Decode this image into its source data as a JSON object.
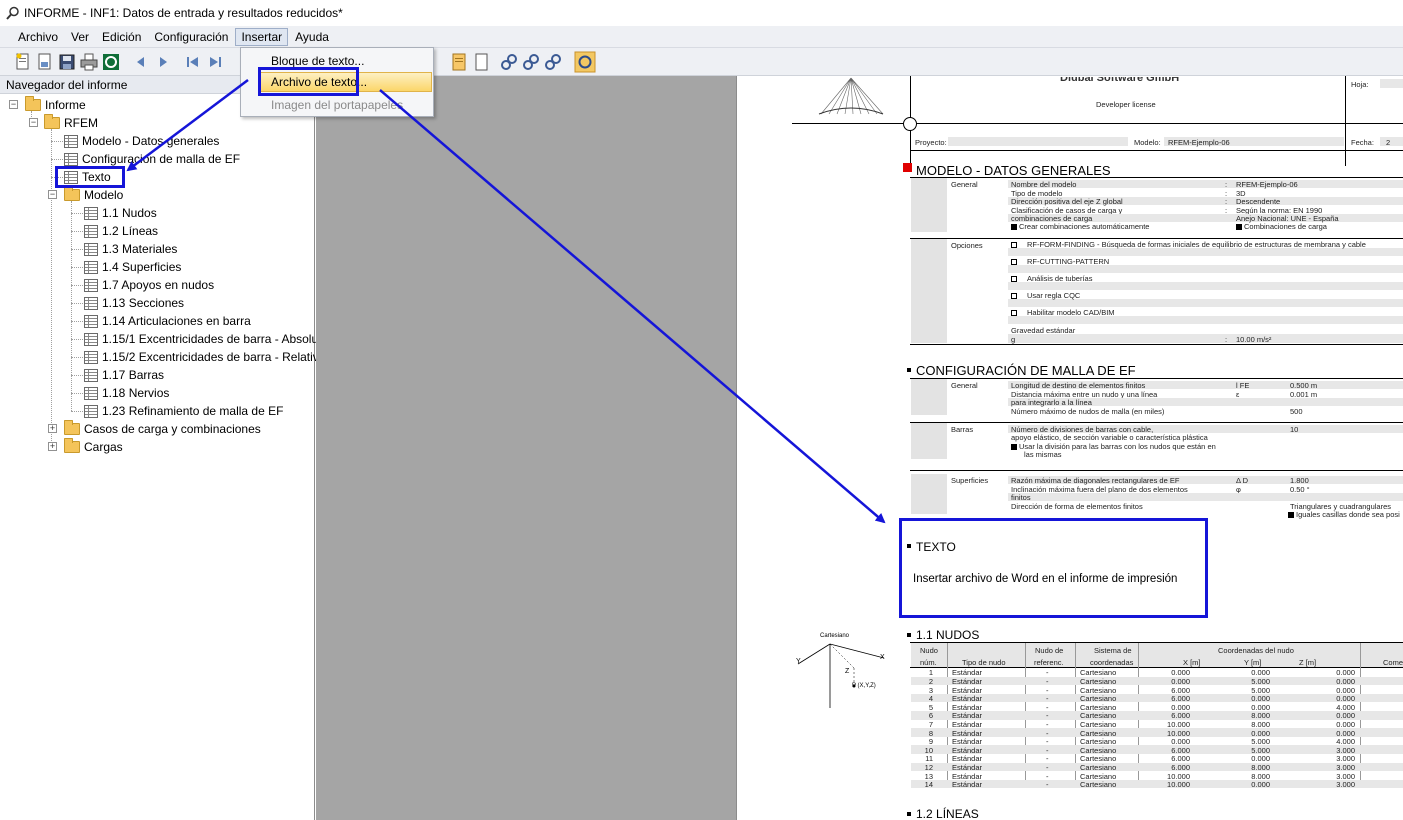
{
  "window": {
    "title": "INFORME - INF1: Datos de entrada y resultados reducidos*"
  },
  "menubar": {
    "items": [
      "Archivo",
      "Ver",
      "Edición",
      "Configuración",
      "Insertar",
      "Ayuda"
    ],
    "active": "Insertar"
  },
  "dropdown": {
    "items": [
      "Bloque de texto...",
      "Archivo de texto...",
      "Imagen del portapapeles"
    ],
    "highlighted": "Archivo de texto..."
  },
  "navigator": {
    "title": "Navegador del informe",
    "root": "Informe",
    "rfem": "RFEM",
    "items": [
      "Modelo - Datos generales",
      "Configuración de malla de EF",
      "Texto"
    ],
    "modelo": "Modelo",
    "modelo_items": [
      "1.1 Nudos",
      "1.2 Líneas",
      "1.3 Materiales",
      "1.4 Superficies",
      "1.7 Apoyos en nudos",
      "1.13 Secciones",
      "1.14 Articulaciones en barra",
      "1.15/1 Excentricidades de barra - Absolu",
      "1.15/2 Excentricidades de barra - Relativ",
      "1.17 Barras",
      "1.18 Nervios",
      "1.23 Refinamiento de malla de EF"
    ],
    "bottom": [
      "Casos de carga y combinaciones",
      "Cargas"
    ]
  },
  "doc": {
    "company": "Dlubal Software GmbH",
    "license": "Developer license",
    "sheet_label": "Hoja:",
    "proyecto_label": "Proyecto:",
    "modelo_label": "Modelo:",
    "modelo_value": "RFEM-Ejemplo-06",
    "fecha_label": "Fecha:",
    "fecha_value": "2",
    "sec1": {
      "title": "MODELO - DATOS GENERALES",
      "general_label": "General",
      "rows": [
        {
          "k": "Nombre del modelo",
          "v": "RFEM-Ejemplo-06"
        },
        {
          "k": "Tipo de modelo",
          "v": "3D"
        },
        {
          "k": "Dirección positiva del eje Z global",
          "v": "Descendente"
        },
        {
          "k": "Clasificación de casos de carga y",
          "v": "Según la norma: EN 1990"
        },
        {
          "k": "combinaciones de carga",
          "v": "Anejo Nacional: UNE - España"
        }
      ],
      "chk1": "Crear combinaciones automáticamente",
      "chk2": "Combinaciones de carga",
      "opciones_label": "Opciones",
      "opts": [
        "RF-FORM-FINDING - Búsqueda de formas iniciales de equilibrio de estructuras de membrana y cable",
        "RF-CUTTING-PATTERN",
        "Análisis de tuberías",
        "Usar regla CQC",
        "Habilitar modelo CAD/BIM"
      ],
      "gravity_label": "Gravedad estándar",
      "g_label": "g",
      "g_value": "10.00 m/s²"
    },
    "sec2": {
      "title": "CONFIGURACIÓN DE MALLA DE EF",
      "general_label": "General",
      "rows": [
        {
          "k": "Longitud de destino de elementos finitos",
          "s": "l FE",
          "v": "0.500 m"
        },
        {
          "k": "Distancia máxima entre un nudo y una línea",
          "s": "ε",
          "v": "0.001 m"
        },
        {
          "k": "para integrarlo a la línea",
          "s": "",
          "v": ""
        },
        {
          "k": "Número máximo de nudos de malla (en miles)",
          "s": "",
          "v": "500"
        }
      ],
      "barras_label": "Barras",
      "barras_rows": [
        {
          "k": "Número de divisiones de barras con cable,",
          "v": "10"
        },
        {
          "k": "apoyo elástico, de sección variable o característica plástica",
          "v": ""
        }
      ],
      "barras_chk": "Usar la división para las barras con los nudos que están en",
      "barras_chk2": "las mismas",
      "sup_label": "Superficies",
      "sup_rows": [
        {
          "k": "Razón máxima de diagonales rectangulares de EF",
          "s": "Δ D",
          "v": "1.800"
        },
        {
          "k": "Inclinación máxima fuera del plano de dos elementos",
          "s": "φ",
          "v": "0.50 °"
        },
        {
          "k": "finitos",
          "s": "",
          "v": ""
        },
        {
          "k": "Dirección de forma de elementos finitos",
          "s": "",
          "v": "Triangulares y cuadrangulares"
        }
      ],
      "sup_chk": "Iguales casillas donde sea posi"
    },
    "texto": {
      "title": "TEXTO",
      "body": "Insertar archivo de Word en el informe de impresión"
    },
    "sec11": {
      "title": "1.1 NUDOS",
      "coord_label": "Cartesiano",
      "axis_labels": [
        "X",
        "Y",
        "Z",
        "P (X,Y,Z)"
      ],
      "header_top": [
        "Nudo",
        "Nudo de",
        "Sistema de",
        "Coordenadas del nudo"
      ],
      "header_bottom": [
        "núm.",
        "Tipo de nudo",
        "referenc.",
        "coordenadas",
        "X [m]",
        "Y [m]",
        "Z [m]",
        "Come"
      ],
      "rows": [
        [
          "1",
          "Estándar",
          "-",
          "Cartesiano",
          "0.000",
          "0.000",
          "0.000"
        ],
        [
          "2",
          "Estándar",
          "-",
          "Cartesiano",
          "0.000",
          "5.000",
          "0.000"
        ],
        [
          "3",
          "Estándar",
          "-",
          "Cartesiano",
          "6.000",
          "5.000",
          "0.000"
        ],
        [
          "4",
          "Estándar",
          "-",
          "Cartesiano",
          "6.000",
          "0.000",
          "0.000"
        ],
        [
          "5",
          "Estándar",
          "-",
          "Cartesiano",
          "0.000",
          "0.000",
          "4.000"
        ],
        [
          "6",
          "Estándar",
          "-",
          "Cartesiano",
          "6.000",
          "8.000",
          "0.000"
        ],
        [
          "7",
          "Estándar",
          "-",
          "Cartesiano",
          "10.000",
          "8.000",
          "0.000"
        ],
        [
          "8",
          "Estándar",
          "-",
          "Cartesiano",
          "10.000",
          "0.000",
          "0.000"
        ],
        [
          "9",
          "Estándar",
          "-",
          "Cartesiano",
          "0.000",
          "5.000",
          "4.000"
        ],
        [
          "10",
          "Estándar",
          "-",
          "Cartesiano",
          "6.000",
          "5.000",
          "3.000"
        ],
        [
          "11",
          "Estándar",
          "-",
          "Cartesiano",
          "6.000",
          "0.000",
          "3.000"
        ],
        [
          "12",
          "Estándar",
          "-",
          "Cartesiano",
          "6.000",
          "8.000",
          "3.000"
        ],
        [
          "13",
          "Estándar",
          "-",
          "Cartesiano",
          "10.000",
          "8.000",
          "3.000"
        ],
        [
          "14",
          "Estándar",
          "-",
          "Cartesiano",
          "10.000",
          "0.000",
          "3.000"
        ]
      ]
    },
    "sec12": {
      "title": "1.2 LÍNEAS"
    }
  },
  "colors": {
    "annotation": "#1515d8",
    "highlight": "#fbd66a",
    "gray_pane": "#a5a5a5",
    "marker_red": "#e00000"
  }
}
